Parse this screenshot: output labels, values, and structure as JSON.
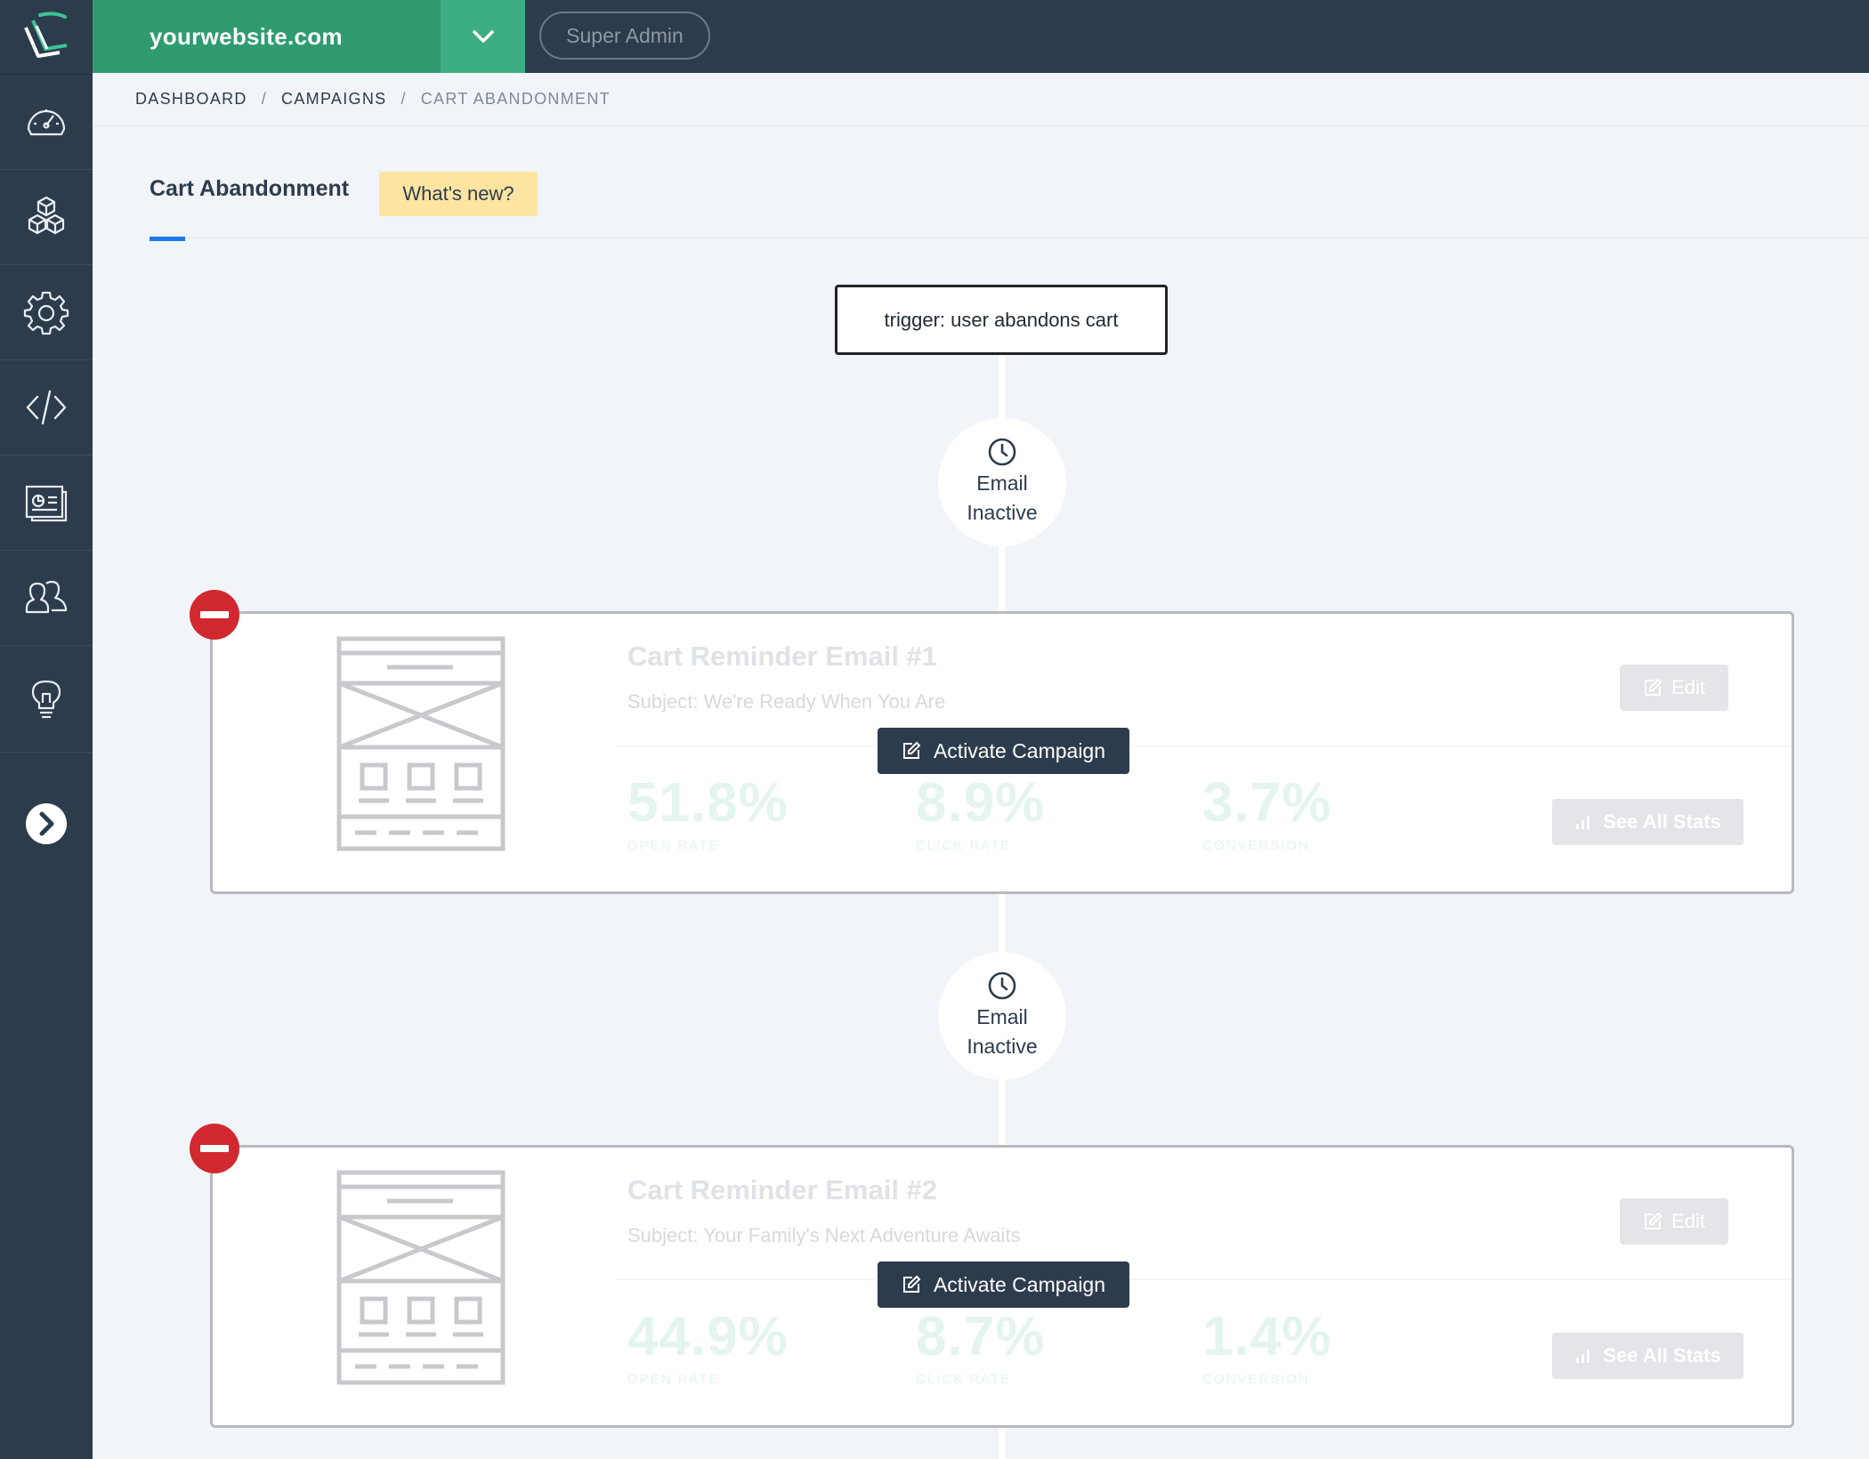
{
  "app": {
    "site_name": "yourwebsite.com",
    "role": "Super Admin"
  },
  "sidebar": {
    "items": [
      {
        "name": "dashboard",
        "icon": "speedometer-icon"
      },
      {
        "name": "products",
        "icon": "cubes-icon"
      },
      {
        "name": "settings",
        "icon": "gear-icon"
      },
      {
        "name": "code",
        "icon": "code-icon"
      },
      {
        "name": "reports",
        "icon": "report-icon"
      },
      {
        "name": "users",
        "icon": "users-icon"
      },
      {
        "name": "ideas",
        "icon": "lightbulb-icon"
      }
    ],
    "expand_icon": "chevron-right-icon"
  },
  "breadcrumb": {
    "items": [
      "DASHBOARD",
      "CAMPAIGNS",
      "CART ABANDONMENT"
    ],
    "separator": "/"
  },
  "page": {
    "title": "Cart Abandonment",
    "whats_new": "What's new?"
  },
  "flow": {
    "trigger": "trigger: user abandons cart",
    "delays": [
      {
        "line1": "Email",
        "line2": "Inactive"
      },
      {
        "line1": "Email",
        "line2": "Inactive"
      }
    ],
    "emails": [
      {
        "title": "Cart Reminder Email #1",
        "subject": "Subject: We're Ready When You Are",
        "edit_label": "Edit",
        "activate_label": "Activate Campaign",
        "stats_label": "See All Stats",
        "stats": [
          {
            "value": "51.8%",
            "label": "OPEN RATE"
          },
          {
            "value": "8.9%",
            "label": "CLICK RATE"
          },
          {
            "value": "3.7%",
            "label": "CONVERSION"
          }
        ]
      },
      {
        "title": "Cart Reminder Email #2",
        "subject": "Subject: Your Family's Next Adventure Awaits",
        "edit_label": "Edit",
        "activate_label": "Activate Campaign",
        "stats_label": "See All Stats",
        "stats": [
          {
            "value": "44.9%",
            "label": "OPEN RATE"
          },
          {
            "value": "8.7%",
            "label": "CLICK RATE"
          },
          {
            "value": "1.4%",
            "label": "CONVERSION"
          }
        ]
      }
    ]
  },
  "colors": {
    "sidebar": "#2d3c4d",
    "brand_green": "#2f9b6f",
    "accent_blue": "#1b7ae8",
    "remove_red": "#d22930",
    "whats_new_bg": "#fde4a1"
  }
}
